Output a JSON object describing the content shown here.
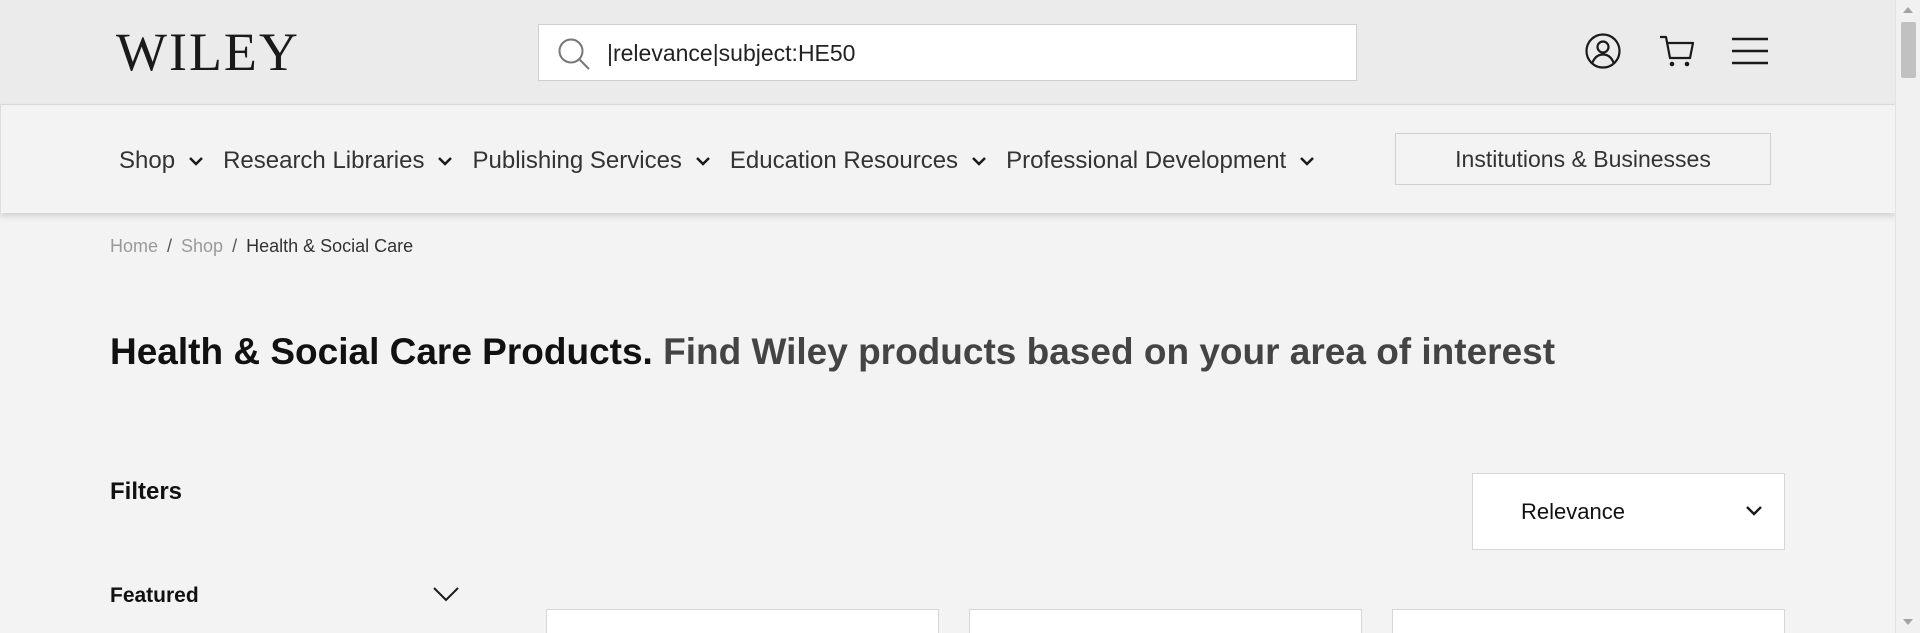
{
  "header": {
    "logo_text": "WILEY",
    "search": {
      "value": "|relevance|subject:HE50",
      "placeholder": ""
    },
    "icons": [
      "user-icon",
      "cart-icon",
      "menu-icon"
    ]
  },
  "nav": {
    "items": [
      {
        "label": "Shop"
      },
      {
        "label": "Research Libraries"
      },
      {
        "label": "Publishing Services"
      },
      {
        "label": "Education Resources"
      },
      {
        "label": "Professional Development"
      }
    ],
    "institutions_button": "Institutions & Businesses"
  },
  "breadcrumb": {
    "items": [
      "Home",
      "Shop",
      "Health & Social Care"
    ],
    "separator": "/"
  },
  "page": {
    "title_bold": "Health & Social Care Products.",
    "title_rest": "Find Wiley products based on your area of interest"
  },
  "filters": {
    "heading": "Filters",
    "sections": [
      {
        "label": "Featured"
      }
    ]
  },
  "sort": {
    "selected": "Relevance"
  },
  "colors": {
    "header_bg": "#ebebeb",
    "page_bg": "#f3f3f3",
    "text": "#1a1a1a",
    "muted": "#9a9a9a"
  }
}
